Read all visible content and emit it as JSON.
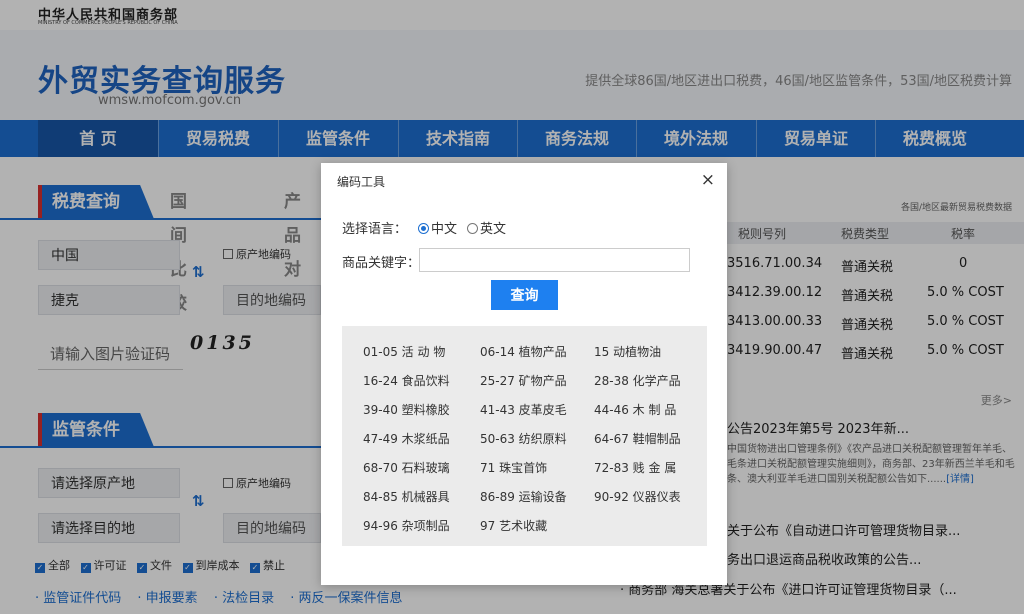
{
  "header": {
    "ministry_cn": "中华人民共和国商务部",
    "ministry_en": "MINISTRY OF COMMERCE PEOPLE'S REPUBLIC OF CHINA",
    "site_title": "外贸实务查询服务",
    "site_url": "wmsw.mofcom.gov.cn",
    "slogan": "提供全球86国/地区进出口税费，46国/地区监管条件，53国/地区税费计算"
  },
  "nav": [
    "首 页",
    "贸易税费",
    "监管条件",
    "技术指南",
    "商务法规",
    "境外法规",
    "贸易单证",
    "税费概览"
  ],
  "tariff_query": {
    "tabs": [
      "税费查询",
      "国间比较",
      "产品对"
    ],
    "origin_value": "中国",
    "origin_code_label": "原产地编码",
    "destination_value": "捷克",
    "destination_code_placeholder": "目的地编码",
    "captcha_placeholder": "请输入图片验证码",
    "captcha_text": "0135"
  },
  "regulatory": {
    "title": "监管条件",
    "origin_placeholder": "请选择原产地",
    "origin_code_label": "原产地编码",
    "destination_placeholder": "请选择目的地",
    "destination_code_placeholder": "目的地编码",
    "filters": [
      "全部",
      "许可证",
      "文件",
      "到岸成本",
      "禁止"
    ],
    "links": [
      "· 监管证件代码",
      "· 申报要素",
      "· 法检目录",
      "· 两反一保案件信息"
    ]
  },
  "rate_table": {
    "caption": "各国/地区最新贸易税费数据",
    "headers": [
      "税则号列",
      "税费类型",
      "税率"
    ],
    "rows": [
      [
        "3516.71.00.34",
        "普通关税",
        "0"
      ],
      [
        "3412.39.00.12",
        "普通关税",
        "5.0 % COST"
      ],
      [
        "3413.00.00.33",
        "普通关税",
        "5.0 % COST"
      ],
      [
        "3419.90.00.47",
        "普通关税",
        "5.0 % COST"
      ]
    ],
    "more": "更多>"
  },
  "news": {
    "headline": "公告2023年第5号 2023年新...",
    "desc": "中国货物进出口管理条例》《农产品进口关税配额管理暂年羊毛、毛条进口关税配额管理实施细则》，商务部、23年新西兰羊毛和毛条、澳大利亚羊毛进口国别关税配额公告如下......",
    "desc_more": "[详情]",
    "items": [
      "关于公布《自动进口许可管理货物目录...",
      "务出口退运商品税收政策的公告...",
      "· 商务部 海关总署关于公布《进口许可证管理货物目录（..."
    ]
  },
  "modal": {
    "title": "编码工具",
    "close": "×",
    "language_label": "选择语言：",
    "lang_options": [
      "中文",
      "英文"
    ],
    "selected_lang": "中文",
    "keyword_label": "商品关键字：",
    "keyword_value": "",
    "keyword_placeholder": "",
    "query_button": "查询",
    "categories": [
      "01-05 活 动 物",
      "06-14 植物产品",
      "15 动植物油",
      "16-24 食品饮料",
      "25-27 矿物产品",
      "28-38 化学产品",
      "39-40 塑料橡胶",
      "41-43 皮革皮毛",
      "44-46 木 制 品",
      "47-49 木浆纸品",
      "50-63 纺织原料",
      "64-67 鞋帽制品",
      "68-70 石料玻璃",
      "71 珠宝首饰",
      "72-83 贱 金 属",
      "84-85 机械器具",
      "86-89 运输设备",
      "90-92 仪器仪表",
      "94-96 杂项制品",
      "97 艺术收藏"
    ]
  },
  "colors": {
    "primary": "#1d6fd1",
    "button": "#1e80f0",
    "accent_red": "#d93030",
    "panel": "#ebebeb"
  }
}
